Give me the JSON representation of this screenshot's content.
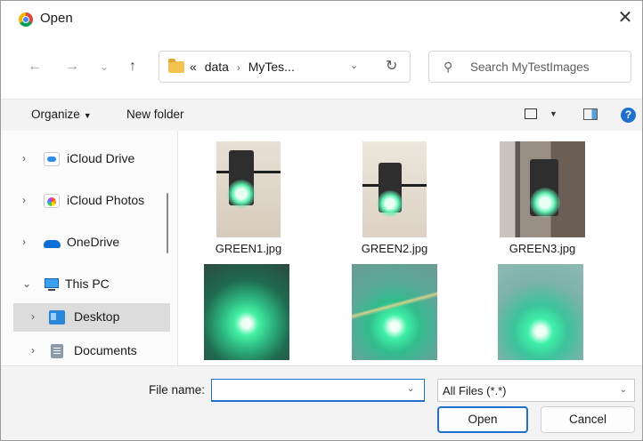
{
  "window": {
    "title": "Open",
    "icon": "chrome-icon",
    "close_glyph": "✕"
  },
  "nav": {
    "back": "←",
    "forward": "→",
    "recent": "⌄",
    "up": "↑",
    "breadcrumb": [
      "«",
      "data",
      "MyTes..."
    ],
    "breadcrumb_sep": "›",
    "address_chevron": "⌄",
    "refresh": "↻",
    "search_placeholder": "Search MyTestImages"
  },
  "toolbar": {
    "organize": "Organize",
    "organize_caret": "▼",
    "new_folder": "New folder",
    "view_caret": "▼",
    "help": "?"
  },
  "sidebar": {
    "items": [
      {
        "label": "iCloud Drive",
        "chevron": "›",
        "icon": "icloud-drive-icon"
      },
      {
        "label": "iCloud Photos",
        "chevron": "›",
        "icon": "icloud-photos-icon"
      },
      {
        "label": "OneDrive",
        "chevron": "›",
        "icon": "onedrive-icon"
      },
      {
        "label": "This PC",
        "chevron": "⌄",
        "icon": "this-pc-icon"
      },
      {
        "label": "Desktop",
        "chevron": "›",
        "icon": "desktop-folder-icon",
        "selected": true
      },
      {
        "label": "Documents",
        "chevron": "›",
        "icon": "documents-folder-icon"
      }
    ]
  },
  "files": [
    {
      "name": "GREEN1.jpg"
    },
    {
      "name": "GREEN2.jpg"
    },
    {
      "name": "GREEN3.jpg"
    },
    {
      "name": ""
    },
    {
      "name": ""
    },
    {
      "name": ""
    }
  ],
  "footer": {
    "file_name_label": "File name:",
    "file_name_value": "",
    "file_name_chevron": "⌄",
    "filter": "All Files (*.*)",
    "filter_chevron": "⌄",
    "open": "Open",
    "cancel": "Cancel"
  }
}
